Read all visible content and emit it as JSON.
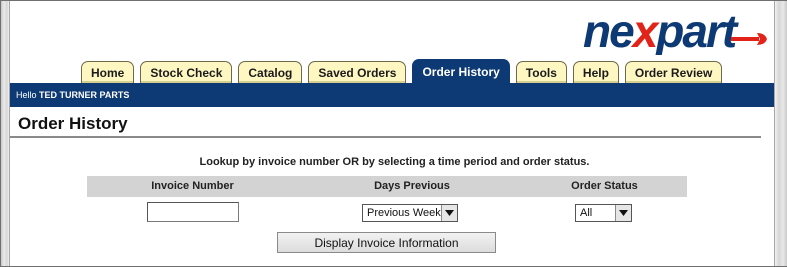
{
  "logo": {
    "text_part1": "ne",
    "text_part2": "x",
    "text_part3": "part"
  },
  "tabs": [
    {
      "label": "Home",
      "active": false
    },
    {
      "label": "Stock Check",
      "active": false
    },
    {
      "label": "Catalog",
      "active": false
    },
    {
      "label": "Saved Orders",
      "active": false
    },
    {
      "label": "Order History",
      "active": true
    },
    {
      "label": "Tools",
      "active": false
    },
    {
      "label": "Help",
      "active": false
    },
    {
      "label": "Order Review",
      "active": false
    }
  ],
  "navbar": {
    "greeting": "Hello",
    "user_name": "TED TURNER PARTS"
  },
  "page": {
    "title": "Order History"
  },
  "lookup": {
    "instructions": "Lookup by invoice number OR by selecting a time period and order status.",
    "columns": {
      "invoice_number": "Invoice Number",
      "days_previous": "Days Previous",
      "order_status": "Order Status"
    },
    "invoice_number_value": "",
    "days_previous_selected": "Previous Week",
    "order_status_selected": "All",
    "submit_label": "Display Invoice Information"
  },
  "colors": {
    "brand_blue": "#0d3a74",
    "brand_red": "#e2231a",
    "tab_bg": "#fff7c2",
    "header_row_bg": "#d3d3d3"
  },
  "icons": {
    "dropdown": "chevron-down-icon",
    "logo_wrench": "wrench-icon"
  }
}
